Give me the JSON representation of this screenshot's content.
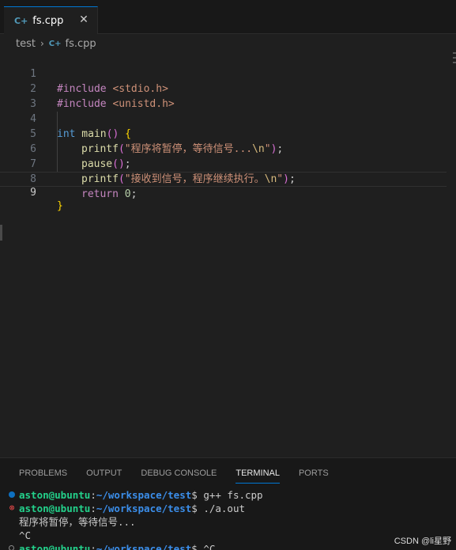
{
  "tab": {
    "icon": "C+",
    "label": "fs.cpp",
    "close": "✕"
  },
  "breadcrumb": {
    "folder": "test",
    "separator": "›",
    "icon": "C+",
    "file": "fs.cpp"
  },
  "editor": {
    "current_line": 9,
    "lines": [
      {
        "n": "1"
      },
      {
        "n": "2"
      },
      {
        "n": "3"
      },
      {
        "n": "4"
      },
      {
        "n": "5"
      },
      {
        "n": "6"
      },
      {
        "n": "7"
      },
      {
        "n": "8"
      },
      {
        "n": "9"
      }
    ],
    "code": {
      "l1_pre": "#include",
      "l1_inc": " <stdio.h>",
      "l2_pre": "#include",
      "l2_inc": " <unistd.h>",
      "l4_kw": "int",
      "l4_fn": " main",
      "l4_p": "()",
      "l4_b": " {",
      "l5_fn": "printf",
      "l5_o": "(",
      "l5_s": "\"程序将暂停，等待信号...",
      "l5_e": "\\n",
      "l5_q": "\"",
      "l5_c": ")",
      "l5_end": ";",
      "l6_fn": "pause",
      "l6_p": "()",
      "l6_end": ";",
      "l7_fn": "printf",
      "l7_o": "(",
      "l7_s": "\"接收到信号，程序继续执行。",
      "l7_e": "\\n",
      "l7_q": "\"",
      "l7_c": ")",
      "l7_end": ";",
      "l8_kw": "return",
      "l8_n": " 0",
      "l8_end": ";",
      "l9_b": "}"
    }
  },
  "panel": {
    "tabs": [
      "PROBLEMS",
      "OUTPUT",
      "DEBUG CONSOLE",
      "TERMINAL",
      "PORTS"
    ],
    "active_tab": "TERMINAL"
  },
  "terminal": {
    "l1_user": "aston@ubuntu",
    "l1_colon": ":",
    "l1_path": "~/workspace/test",
    "l1_cmd": "$ g++ fs.cpp",
    "l2_user": "aston@ubuntu",
    "l2_colon": ":",
    "l2_path": "~/workspace/test",
    "l2_cmd": "$ ./a.out",
    "l3": "程序将暂停，等待信号...",
    "l4": "^C",
    "l5_user": "aston@ubuntu",
    "l5_colon": ":",
    "l5_path": "~/workspace/test",
    "l5_cmd": "$ ^C",
    "icons": {
      "ok": "circle-filled-blue",
      "err": "error-x-red",
      "neutral": "circle-outline"
    }
  },
  "watermark": "CSDN @li星野",
  "colors": {
    "accent": "#0078d4",
    "keyword": "#569cd6",
    "function": "#dcdcaa",
    "string": "#ce9178",
    "preprocessor": "#c586c0",
    "terminal_user": "#23d18b",
    "terminal_path": "#3b8eea"
  }
}
